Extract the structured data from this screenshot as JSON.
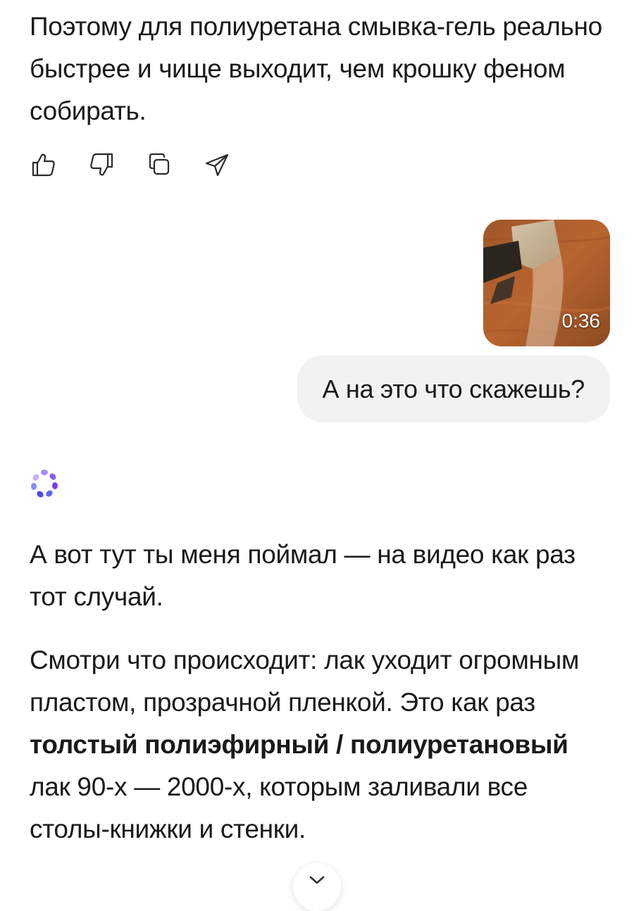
{
  "previous_message": {
    "text": "Поэтому для полиуретана смывка-гель реально быстрее и чище выходит, чем крошку феном собирать."
  },
  "message_actions": [
    {
      "name": "thumbs-up-icon"
    },
    {
      "name": "thumbs-down-icon"
    },
    {
      "name": "copy-icon"
    },
    {
      "name": "share-icon"
    }
  ],
  "user_message": {
    "video": {
      "duration": "0:36"
    },
    "text": "А на это что скажешь?"
  },
  "assistant_reply": {
    "p1": "А вот тут ты меня поймал — на видео как раз тот случай.",
    "p2_intro": "Смотри что происходит: лак уходит огромным пластом, прозрачной пленкой. Это как раз ",
    "p2_bold": "толстый полиэфирный / полиуретановый",
    "p2_tail": " лак 90-х — 2000-х, которым заливали все столы-книжки и стенки."
  },
  "colors": {
    "bubble_bg": "#f2f2f3",
    "logo_purple": "#8b5cf6",
    "logo_blue": "#6366f1"
  },
  "icons": {
    "scroll_down": "chevron-down-icon",
    "assistant_logo": "assistant-logo-icon"
  }
}
